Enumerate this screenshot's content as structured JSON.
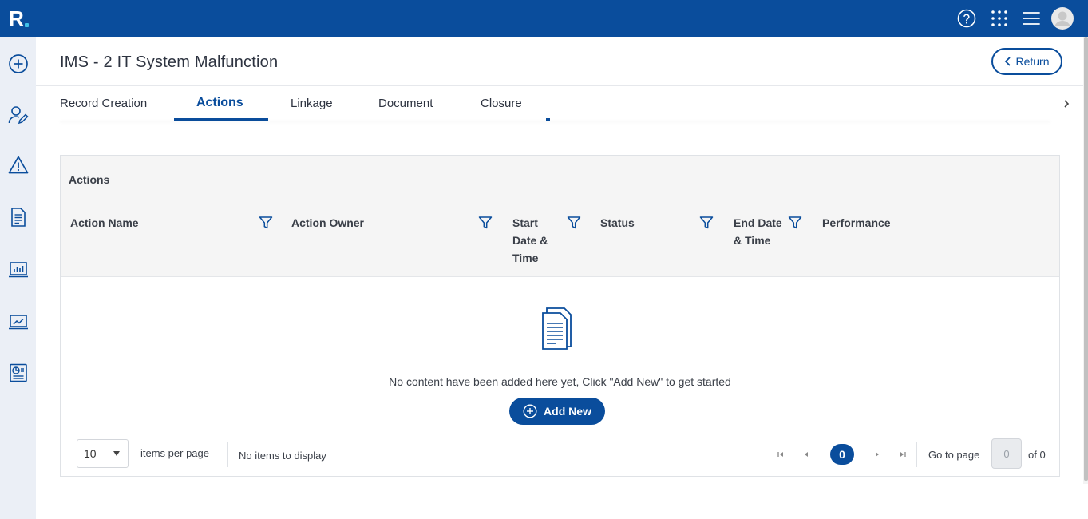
{
  "app": {
    "logo_text": "R"
  },
  "topbar": {
    "icons": [
      "help-icon",
      "apps-grid-icon",
      "menu-icon",
      "user-avatar"
    ]
  },
  "sidebar": {
    "icons": [
      "add-circle-icon",
      "user-edit-icon",
      "warning-icon",
      "document-icon",
      "dashboard-chart-icon",
      "trend-chart-icon",
      "report-icon"
    ]
  },
  "header": {
    "title": "IMS - 2 IT System Malfunction",
    "return_label": "Return"
  },
  "tabs": [
    {
      "label": "Record Creation",
      "active": false
    },
    {
      "label": "Actions",
      "active": true
    },
    {
      "label": "Linkage",
      "active": false
    },
    {
      "label": "Document",
      "active": false
    },
    {
      "label": "Closure",
      "active": false
    }
  ],
  "panel": {
    "title": "Actions",
    "columns": [
      {
        "label": "Action Name",
        "filter": true
      },
      {
        "label": "Action Owner",
        "filter": true
      },
      {
        "label": "Start Date & Time",
        "filter": true
      },
      {
        "label": "Status",
        "filter": true
      },
      {
        "label": "End Date & Time",
        "filter": true
      },
      {
        "label": "Performance",
        "filter": false
      }
    ],
    "empty_message": "No content have been added here yet, Click \"Add New\" to get started",
    "add_label": "Add New"
  },
  "pager": {
    "page_size": "10",
    "items_per_page_label": "items per page",
    "no_items_label": "No items to display",
    "current_page": "0",
    "go_to_label": "Go to page",
    "page_input_value": "0",
    "of_label": "of 0"
  },
  "colors": {
    "brand": "#0a4d9c",
    "sidebar_bg": "#ebeff6",
    "header_bg": "#f5f5f5"
  }
}
